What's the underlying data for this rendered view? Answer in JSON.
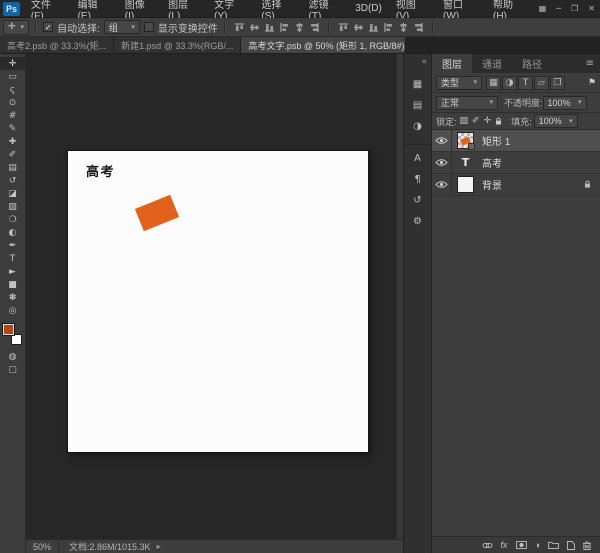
{
  "app": {
    "logo": "Ps",
    "menus": [
      "文件(F)",
      "编辑(E)",
      "图像(I)",
      "图层(L)",
      "文字(Y)",
      "选择(S)",
      "滤镜(T)",
      "3D(D)",
      "视图(V)",
      "窗口(W)",
      "帮助(H)"
    ],
    "window": {
      "layout": "▦",
      "minimize": "─",
      "restore": "❐",
      "close": "✕"
    }
  },
  "icons": {
    "caret": "▾",
    "check": "✓",
    "close": "✕",
    "collapse": "«",
    "menu": "≡",
    "arrow": "▸",
    "flag": "⚑",
    "adjustment": "◑"
  },
  "options": {
    "tool_glyph": "✛",
    "auto_select_label": "自动选择:",
    "auto_select_value": "组",
    "show_transform_label": "显示变换控件"
  },
  "tabs": [
    {
      "label": "高考2.psb @ 33.3%(矩...",
      "active": false
    },
    {
      "label": "新建1.psd @ 33.3%(RGB/...",
      "active": false
    },
    {
      "label": "高考文字.psb @ 50% (矩形 1, RGB/8#) *",
      "active": true
    }
  ],
  "tools": [
    {
      "name": "move",
      "glyph": "✛"
    },
    {
      "name": "rectangular-marquee",
      "glyph": "▭"
    },
    {
      "name": "lasso",
      "glyph": "ς"
    },
    {
      "name": "quick-selection",
      "glyph": "⊙"
    },
    {
      "name": "crop",
      "glyph": "#"
    },
    {
      "name": "eyedropper",
      "glyph": "✎"
    },
    {
      "name": "spot-healing-brush",
      "glyph": "✚"
    },
    {
      "name": "brush",
      "glyph": "✐"
    },
    {
      "name": "clone-stamp",
      "glyph": "▤"
    },
    {
      "name": "history-brush",
      "glyph": "↺"
    },
    {
      "name": "eraser",
      "glyph": "◪"
    },
    {
      "name": "gradient",
      "glyph": "▨"
    },
    {
      "name": "blur",
      "glyph": "❍"
    },
    {
      "name": "dodge",
      "glyph": "◐"
    },
    {
      "name": "pen",
      "glyph": "✒"
    },
    {
      "name": "horizontal-type",
      "glyph": "T"
    },
    {
      "name": "path-selection",
      "glyph": "►"
    },
    {
      "name": "rectangle",
      "glyph": "■"
    },
    {
      "name": "hand",
      "glyph": "✽"
    },
    {
      "name": "zoom",
      "glyph": "◎"
    }
  ],
  "toolbar_extras": {
    "quick_mask": "◍",
    "screen_mode": "▢"
  },
  "canvas": {
    "title_text": "高考"
  },
  "dock": {
    "icons": [
      {
        "name": "color",
        "glyph": "▦"
      },
      {
        "name": "swatches",
        "glyph": "▤"
      },
      {
        "name": "adjustments",
        "glyph": "◑"
      },
      {
        "name": "character",
        "glyph": "A"
      },
      {
        "name": "paragraph",
        "glyph": "¶"
      },
      {
        "name": "history",
        "glyph": "↺"
      },
      {
        "name": "properties",
        "glyph": "⚙"
      }
    ]
  },
  "layers_panel": {
    "tabs": [
      {
        "label": "图层",
        "active": true
      },
      {
        "label": "通道",
        "active": false
      },
      {
        "label": "路径",
        "active": false
      }
    ],
    "filter": {
      "label": "类型",
      "icons": [
        {
          "name": "filter-pixel-layers",
          "glyph": "▦"
        },
        {
          "name": "filter-adjustment-layers",
          "glyph": "◑"
        },
        {
          "name": "filter-type-layers",
          "glyph": "T"
        },
        {
          "name": "filter-shape-layers",
          "glyph": "▱"
        },
        {
          "name": "filter-smart-objects",
          "glyph": "❒"
        }
      ]
    },
    "blend": {
      "mode": "正常",
      "opacity_label": "不透明度:",
      "opacity": "100%"
    },
    "lock": {
      "label": "锁定:",
      "icons": [
        {
          "name": "lock-transparent-pixels",
          "glyph": "▨"
        },
        {
          "name": "lock-image-pixels",
          "glyph": "✐"
        },
        {
          "name": "lock-position",
          "glyph": "✛"
        }
      ],
      "fill_label": "填充:",
      "fill": "100%"
    },
    "layers": [
      {
        "name": "矩形 1",
        "type": "shape",
        "selected": true
      },
      {
        "name": "高考",
        "type": "text",
        "thumb_glyph": "T",
        "selected": false
      },
      {
        "name": "背景",
        "type": "background",
        "locked": true,
        "selected": false
      }
    ],
    "fx_label": "fx"
  },
  "status": {
    "zoom": "50%",
    "doc_info": "文档:2.86M/1015.3K"
  },
  "colors": {
    "shape": "#e2611b",
    "foreground-swatch": "#b8431d",
    "selection": "#4f4f4f"
  }
}
